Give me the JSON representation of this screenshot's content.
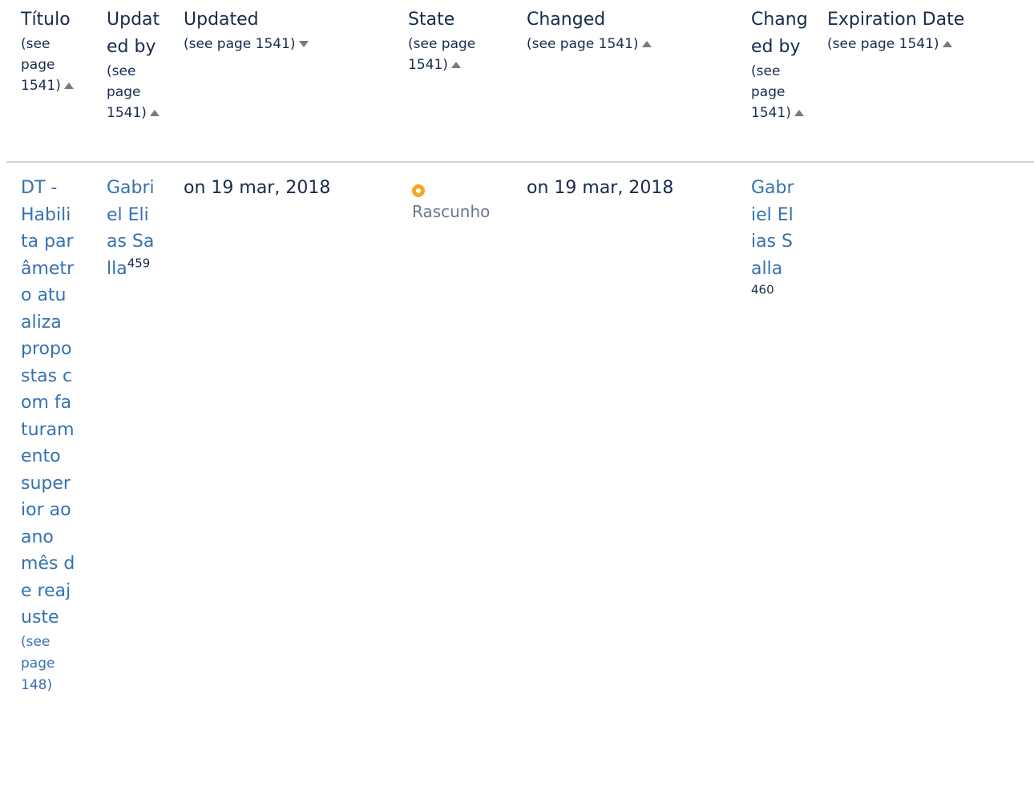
{
  "headers": [
    {
      "name": "Título",
      "note": "(see page 1541)",
      "sort": "up"
    },
    {
      "name": "Updated by",
      "note": "(see page 1541)",
      "sort": "up"
    },
    {
      "name": "Updated",
      "note": "(see page 1541)",
      "sort": "down"
    },
    {
      "name": "State",
      "note": "(see page 1541)",
      "sort": "up"
    },
    {
      "name": "Changed",
      "note": "(see page 1541)",
      "sort": "up"
    },
    {
      "name": "Changed by",
      "note": "(see page 1541)",
      "sort": "up"
    },
    {
      "name": "Expiration Date",
      "note": "(see page 1541)",
      "sort": "up"
    }
  ],
  "row": {
    "title": "DT - Habilita parâmetro atualiza propostas com faturamento superior ao ano mês de reajuste",
    "title_note": "(see page 148)",
    "updated_by": "Gabriel Elias Salla",
    "updated_by_ref": "459",
    "updated": "on 19 mar, 2018",
    "state": "Rascunho",
    "changed": "on 19 mar, 2018",
    "changed_by": "Gabriel Elias Salla",
    "changed_by_ref": "460",
    "expiration_date": ""
  },
  "colors": {
    "link": "#3572b0",
    "text": "#172b4d",
    "state_indicator": "#f5a623",
    "state_text": "#6b778c",
    "divider": "#d0d0d0"
  }
}
